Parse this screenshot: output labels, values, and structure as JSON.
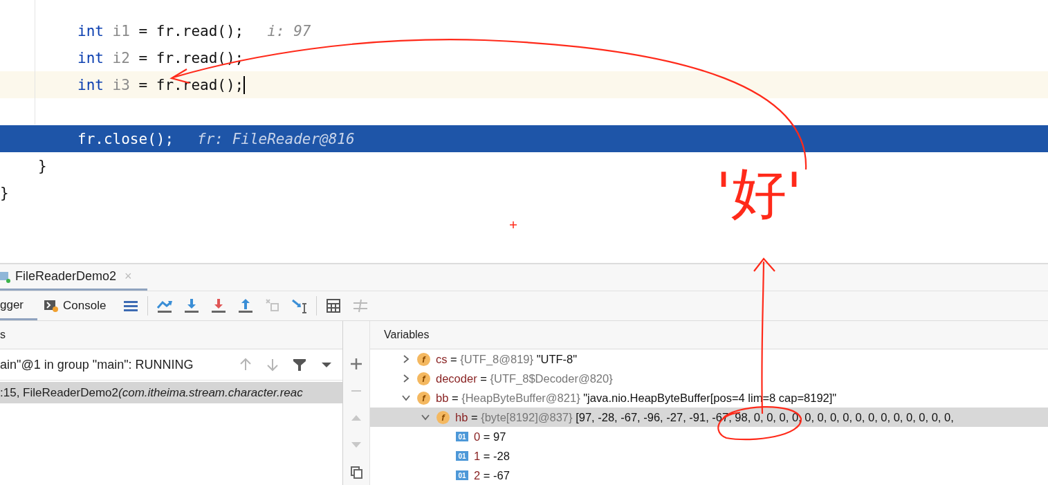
{
  "editor": {
    "lines": [
      {
        "kind": "statement",
        "keyword": "int",
        "variable": "i1",
        "rest": " = fr.read();",
        "hint": "i: 97",
        "caret": false,
        "selected": false
      },
      {
        "kind": "statement",
        "keyword": "int",
        "variable": "i2",
        "rest": " = fr.read();",
        "caret": false,
        "selected": false
      },
      {
        "kind": "statement",
        "keyword": "int",
        "variable": "i3",
        "rest": " = fr.read();",
        "caret": true,
        "selected": false
      },
      {
        "kind": "blank",
        "caret": false,
        "selected": false
      },
      {
        "kind": "statement",
        "rest": "fr.close();",
        "hint": "fr: FileReader@816",
        "caret": false,
        "selected": true
      },
      {
        "kind": "method_end",
        "rest": "}",
        "caret": false,
        "selected": false
      },
      {
        "kind": "class_end",
        "rest": "}",
        "caret": false,
        "selected": false
      }
    ]
  },
  "annotation": {
    "text": "'好'"
  },
  "debug": {
    "run_tab": {
      "label": "FileReaderDemo2",
      "close": "×"
    },
    "tabs": [
      {
        "label": "gger",
        "selected": true
      },
      {
        "label": "Console",
        "selected": false
      }
    ],
    "toolbar": [
      {
        "kind": "layout",
        "disabled": false
      },
      {
        "kind": "step_over",
        "disabled": false
      },
      {
        "kind": "step_into",
        "disabled": false
      },
      {
        "kind": "force_step_into",
        "disabled": false
      },
      {
        "kind": "step_out",
        "disabled": false
      },
      {
        "kind": "drop_frame",
        "disabled": true
      },
      {
        "kind": "run_to_cursor",
        "disabled": false
      },
      {
        "kind": "evaluate",
        "disabled": false
      },
      {
        "kind": "trace",
        "disabled": true
      }
    ],
    "frames": {
      "header": "s",
      "thread": "ain\"@1 in group \"main\": RUNNING",
      "items": [
        {
          "location": ":15, FileReaderDemo2",
          "package": "(com.itheima.stream.character.reac",
          "selected": true
        }
      ]
    },
    "variables": {
      "header": "Variables",
      "equals": "=",
      "items": [
        {
          "badge": "f",
          "name": "cs",
          "type": "{UTF_8@819}",
          "value": "\"UTF-8\"",
          "expanded": false,
          "selected": false
        },
        {
          "badge": "f",
          "name": "decoder",
          "type": "{UTF_8$Decoder@820}",
          "expanded": false,
          "selected": false
        },
        {
          "badge": "f",
          "name": "bb",
          "type": "{HeapByteBuffer@821}",
          "value": "\"java.nio.HeapByteBuffer[pos=4 lim=8 cap=8192]\"",
          "expanded": true,
          "selected": false,
          "children": [
            {
              "badge": "f",
              "name": "hb",
              "type": "{byte[8192]@837}",
              "value": "[97, -28, -67, -96, -27, -91, -67, 98, 0, 0, 0, 0, 0, 0, 0, 0, 0, 0, 0, 0, 0, 0, 0, 0,",
              "expanded": true,
              "selected": true,
              "children": [
                {
                  "badge": "01",
                  "name": "0",
                  "value": "97",
                  "selected": false
                },
                {
                  "badge": "01",
                  "name": "1",
                  "value": "-28",
                  "selected": false
                },
                {
                  "badge": "01",
                  "name": "2",
                  "value": "-67",
                  "selected": false
                }
              ]
            }
          ]
        }
      ]
    }
  }
}
